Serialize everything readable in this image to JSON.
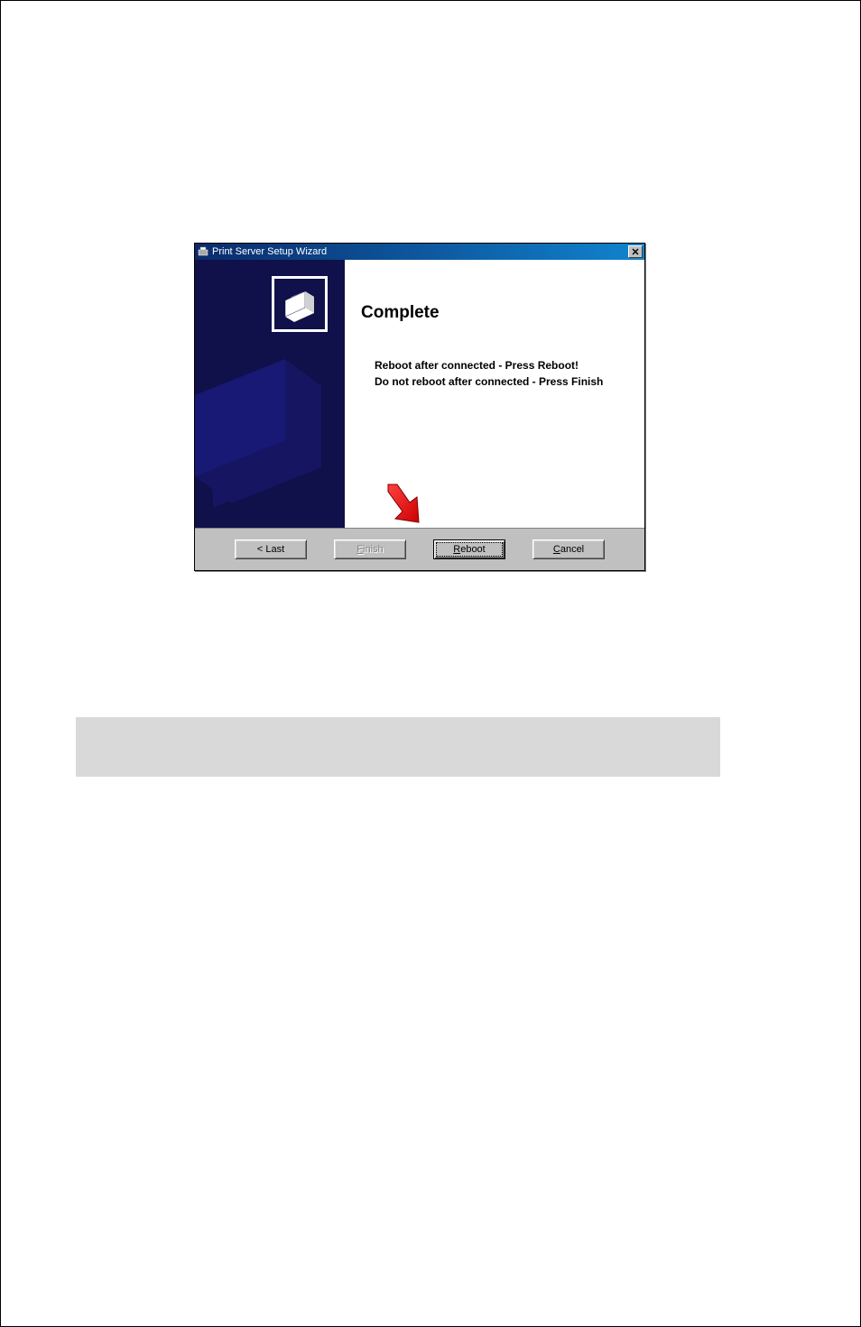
{
  "dialog": {
    "title": "Print Server Setup Wizard",
    "heading": "Complete",
    "message_line1": "Reboot after connected - Press Reboot!",
    "message_line2": "Do not reboot after connected - Press Finish",
    "buttons": {
      "last": "< Last",
      "finish": "Finish",
      "reboot": "Reboot",
      "cancel": "Cancel"
    }
  }
}
